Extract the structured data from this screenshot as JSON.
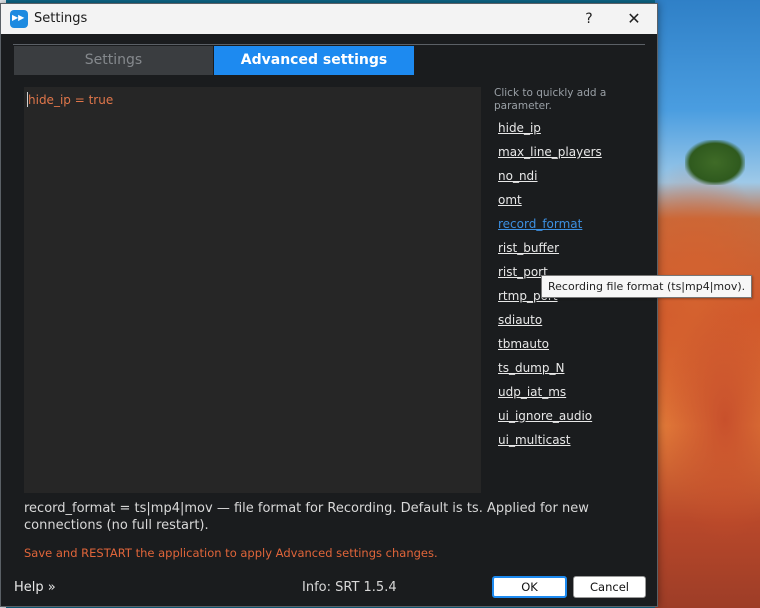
{
  "window": {
    "title": "Settings",
    "help_glyph": "?",
    "close_glyph": "✕"
  },
  "tabs": [
    {
      "label": "Settings",
      "active": false
    },
    {
      "label": "Advanced settings",
      "active": true
    }
  ],
  "editor": {
    "content": "hide_ip = true"
  },
  "quick_add": {
    "hint": "Click to quickly add a parameter.",
    "params": [
      "hide_ip",
      "max_line_players",
      "no_ndi",
      "omt",
      "record_format",
      "rist_buffer",
      "rist_port",
      "rtmp_port",
      "sdiauto",
      "tbmauto",
      "ts_dump_N",
      "udp_iat_ms",
      "ui_ignore_audio",
      "ui_multicast"
    ],
    "hovered_param": "record_format"
  },
  "tooltip": {
    "text": "Recording file format (ts|mp4|mov)."
  },
  "description": "record_format = ts|mp4|mov — file format for Recording. Default is ts. Applied for new connections (no full restart).",
  "restart_note": "Save and RESTART the application to apply Advanced settings changes.",
  "footer": {
    "help_label": "Help »",
    "info_text": "Info: SRT 1.5.4",
    "ok_label": "OK",
    "cancel_label": "Cancel"
  },
  "colors": {
    "accent": "#1d8af0",
    "warning_text": "#e0653a",
    "editor_text": "#e0764a",
    "hover_link": "#3c8fe0"
  }
}
